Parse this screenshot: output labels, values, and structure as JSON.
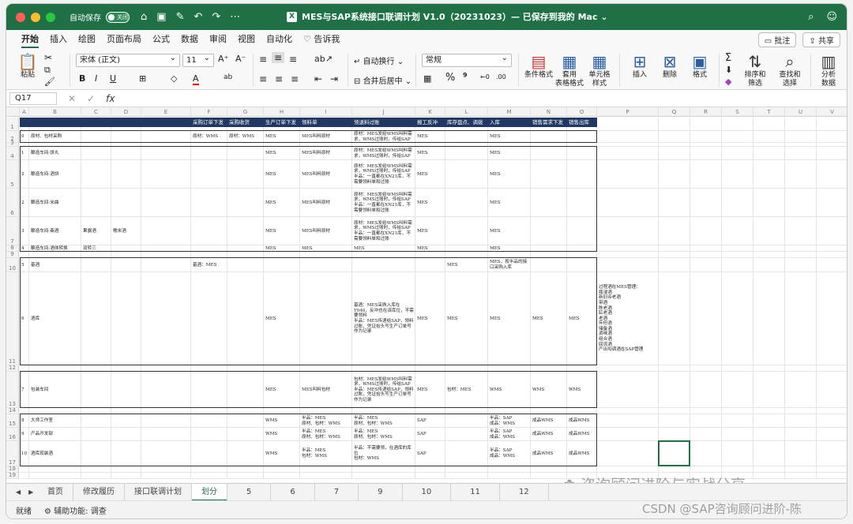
{
  "titlebar": {
    "autosave_label": "自动保存",
    "autosave_state": "关闭",
    "doc_badge": "X",
    "title": "MES与SAP系统接口联调计划 V1.0（20231023）— 已保存到我的 Mac ⌄"
  },
  "ribbon_tabs": [
    "开始",
    "插入",
    "绘图",
    "页面布局",
    "公式",
    "数据",
    "审阅",
    "视图",
    "自动化"
  ],
  "tell_me": "告诉我",
  "comments_btn": "批注",
  "share_btn": "共享",
  "ribbon": {
    "paste": "粘贴",
    "font_name": "宋体 (正文)",
    "font_size": "11",
    "wrap_text": "自动换行",
    "merge_center": "合并后居中",
    "number_format": "常规",
    "cond_format": "条件格式",
    "table_format": "套用\n表格格式",
    "cell_style": "单元格\n样式",
    "insert": "插入",
    "delete": "删除",
    "format": "格式",
    "sort_filter": "排序和\n筛选",
    "find_select": "查找和\n选择",
    "analyze": "分析\n数据"
  },
  "formula_bar": {
    "cell_ref": "Q17",
    "fx": "fx"
  },
  "columns": [
    "A",
    "B",
    "C",
    "D",
    "E",
    "F",
    "G",
    "H",
    "I",
    "J",
    "K",
    "L",
    "M",
    "N",
    "O",
    "P",
    "Q",
    "R",
    "S",
    "T",
    "U",
    "V"
  ],
  "header_row": {
    "F": "采购订单下发",
    "G": "采购收货",
    "H": "生产订单下发",
    "I": "领料单",
    "J": "领退料过账",
    "K": "报工反冲",
    "L": "库存盘点、调拨",
    "M": "入库",
    "N": "销售需求下发",
    "O": "销售出库"
  },
  "rows": [
    {
      "r": "2",
      "A": "0",
      "B": "原材、包材采购",
      "F": "原材：WMS",
      "G": "原材：WMS",
      "H": "MES",
      "I": "MES叫料原材",
      "J": "原材：MES发给WMS叫料需求，WMS过账时，传给SAP",
      "K": "MES",
      "M": "MES"
    },
    {
      "r": "4",
      "A": "1",
      "B": "酿造车间-饼丸",
      "H": "MES",
      "I": "MES叫料原材",
      "J": "原材：MES发给WMS叫料需求，WMS过账时，传给SAP",
      "K": "MES",
      "M": "MES"
    },
    {
      "r": "5",
      "A": "2",
      "B": "酿造车间-酒饼",
      "H": "MES",
      "I": "MES叫料原材",
      "J": "原材：MES发给WMS叫料需求，WMS过账时，传给SAP\n半品：一直都在XN21库，不需要领料单和过账",
      "K": "MES",
      "M": "MES"
    },
    {
      "r": "6",
      "A": "2",
      "B": "酿造车间-米曲",
      "H": "MES",
      "I": "MES叫料原材",
      "J": "原材：MES发给WMS叫料需求，WMS过账时，传给SAP\n半品：一直都在XN21库，不需要领料单和过账",
      "K": "MES",
      "M": "MES"
    },
    {
      "r": "7",
      "A": "3",
      "B": "酿造车间-斋酒",
      "C": "果露酒",
      "D": "糯米酒",
      "H": "MES",
      "I": "MES叫料原材",
      "J": "原材：MES发给WMS叫料需求，WMS过账时，传给SAP\n半品：一直都在XN21库，不需要领料单和过账",
      "K": "MES",
      "M": "MES"
    },
    {
      "r": "8",
      "A": "4",
      "B": "酿造车间-酒体转换",
      "C": "双转三",
      "H": "MES",
      "I": "MES",
      "J": "MES",
      "K": "MES",
      "M": "MES"
    },
    {
      "r": "10",
      "A": "5",
      "B": "基酒",
      "F": "基酒：MES",
      "L": "MES",
      "M": "MES，按半品的接口采购入库"
    },
    {
      "r": "11",
      "A": "6",
      "B": "酒库",
      "H": "MES",
      "J": "基酒：MES采购入库在Y040，反冲也在该库位，不需要领料\n半品：MES传递给SAP，领料过账，凭证抬头写生产订单号作为记录",
      "K": "MES",
      "L": "MES",
      "M": "MES",
      "N": "MES",
      "O": "MES",
      "P": "过程酒在MES管理：\n瓶浸酒\n新旧合老酒\n带酒\n陈老酒\n缸老酒\n老酒\n年份酒\n储备酒\n调味酒\n组合酒\n回流酒\n产出勾调酒在SAP管理"
    },
    {
      "r": "13",
      "A": "7",
      "B": "包装车间",
      "H": "MES",
      "I": "MES叫料包材",
      "J": "包材：MES发给WMS叫料需求，WMS过账时，传给SAP\n半品：MES传递给SAP，领料过账，凭证抬头写生产订单号作为记录",
      "K": "MES",
      "L": "包材：MES",
      "M": "WMS",
      "N": "WMS",
      "O": "WMS"
    },
    {
      "r": "15",
      "A": "8",
      "B": "大师工作室",
      "H": "WMS",
      "I": "半品：MES\n原材、包材：WMS",
      "J": "半品：MES\n原材、包材：WMS",
      "K": "SAP",
      "M": "半品：SAP\n成品：WMS",
      "N": "成品WMS",
      "O": "成品WMS"
    },
    {
      "r": "16",
      "A": "9",
      "B": "产品开发部",
      "H": "WMS",
      "I": "半品：MES\n原材、包材：WMS",
      "J": "半品：MES\n原材、包材：WMS",
      "K": "SAP",
      "M": "半品：SAP\n成品：WMS",
      "N": "成品WMS",
      "O": "成品WMS"
    },
    {
      "r": "17",
      "A": "10",
      "B": "酒库现装酒",
      "H": "WMS",
      "I": "半品：MES\n包材：WMS",
      "J": "半品：不需要领，在酒库的库位\n包材：WMS",
      "K": "SAP",
      "M": "半品：SAP\n成品：WMS",
      "N": "成品WMS",
      "O": "成品WMS"
    }
  ],
  "row_numbers": [
    "1",
    "2",
    "3",
    "4",
    "5",
    "6",
    "7",
    "8",
    "9",
    "10",
    "11",
    "12",
    "13",
    "14",
    "15",
    "16",
    "17",
    "18",
    "19"
  ],
  "sheets": [
    "首页",
    "修改履历",
    "接口联调计划",
    "划分",
    "5",
    "6",
    "7",
    "9",
    "10",
    "11",
    "12"
  ],
  "active_sheet": "划分",
  "status": {
    "ready": "就绪",
    "accessibility": "辅助功能: 调查"
  },
  "watermarks": {
    "wechat": "咨询顾问进阶与实战分享",
    "csdn": "CSDN @SAP咨询顾问进阶-陈"
  },
  "colors": {
    "accent": "#1f7145",
    "header_fill": "#203864"
  }
}
